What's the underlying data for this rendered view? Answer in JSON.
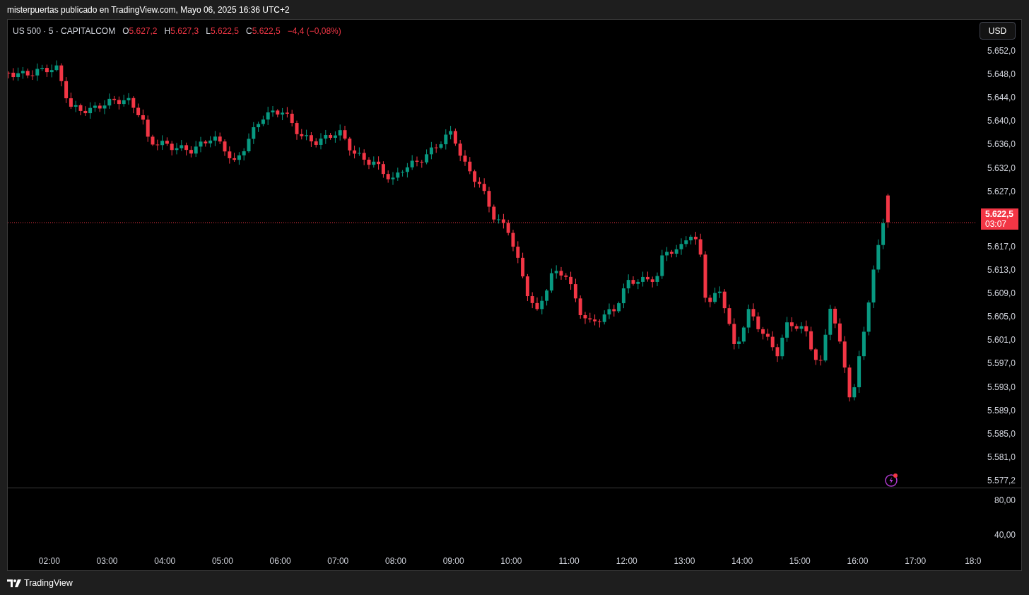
{
  "header": {
    "text": "misterpuertas publicado en TradingView.com, Mayo 06, 2025 16:36 UTC+2"
  },
  "legend": {
    "symbol": "US 500 · 5 · CAPITALCOM",
    "values": [
      {
        "label": "O",
        "value": "5.627,2"
      },
      {
        "label": "H",
        "value": "5.627,3"
      },
      {
        "label": "L",
        "value": "5.622,5"
      },
      {
        "label": "C",
        "value": "5.622,5"
      }
    ],
    "change": "−4,4 (−0,08%)"
  },
  "currency_button": "USD",
  "price_axis_upper": [
    "5.652,0",
    "5.648,0",
    "5.644,0",
    "5.640,0",
    "5.636,0",
    "5.632,0",
    "5.627,0"
  ],
  "last_price": {
    "price": "5.622,5",
    "countdown": "03:07"
  },
  "price_axis_lower": [
    "5.617,0",
    "5.613,0",
    "5.609,0",
    "5.605,0",
    "5.601,0",
    "5.597,0",
    "5.593,0",
    "5.589,0",
    "5.585,0",
    "5.581,0",
    "5.577,2"
  ],
  "indicator_axis": [
    "80,00",
    "40,00"
  ],
  "time_axis": [
    "02:00",
    "03:00",
    "04:00",
    "05:00",
    "06:00",
    "07:00",
    "08:00",
    "09:00",
    "10:00",
    "11:00",
    "12:00",
    "13:00",
    "14:00",
    "15:00",
    "16:00",
    "17:00",
    "18:0"
  ],
  "footer": {
    "brand": "TradingView"
  }
}
